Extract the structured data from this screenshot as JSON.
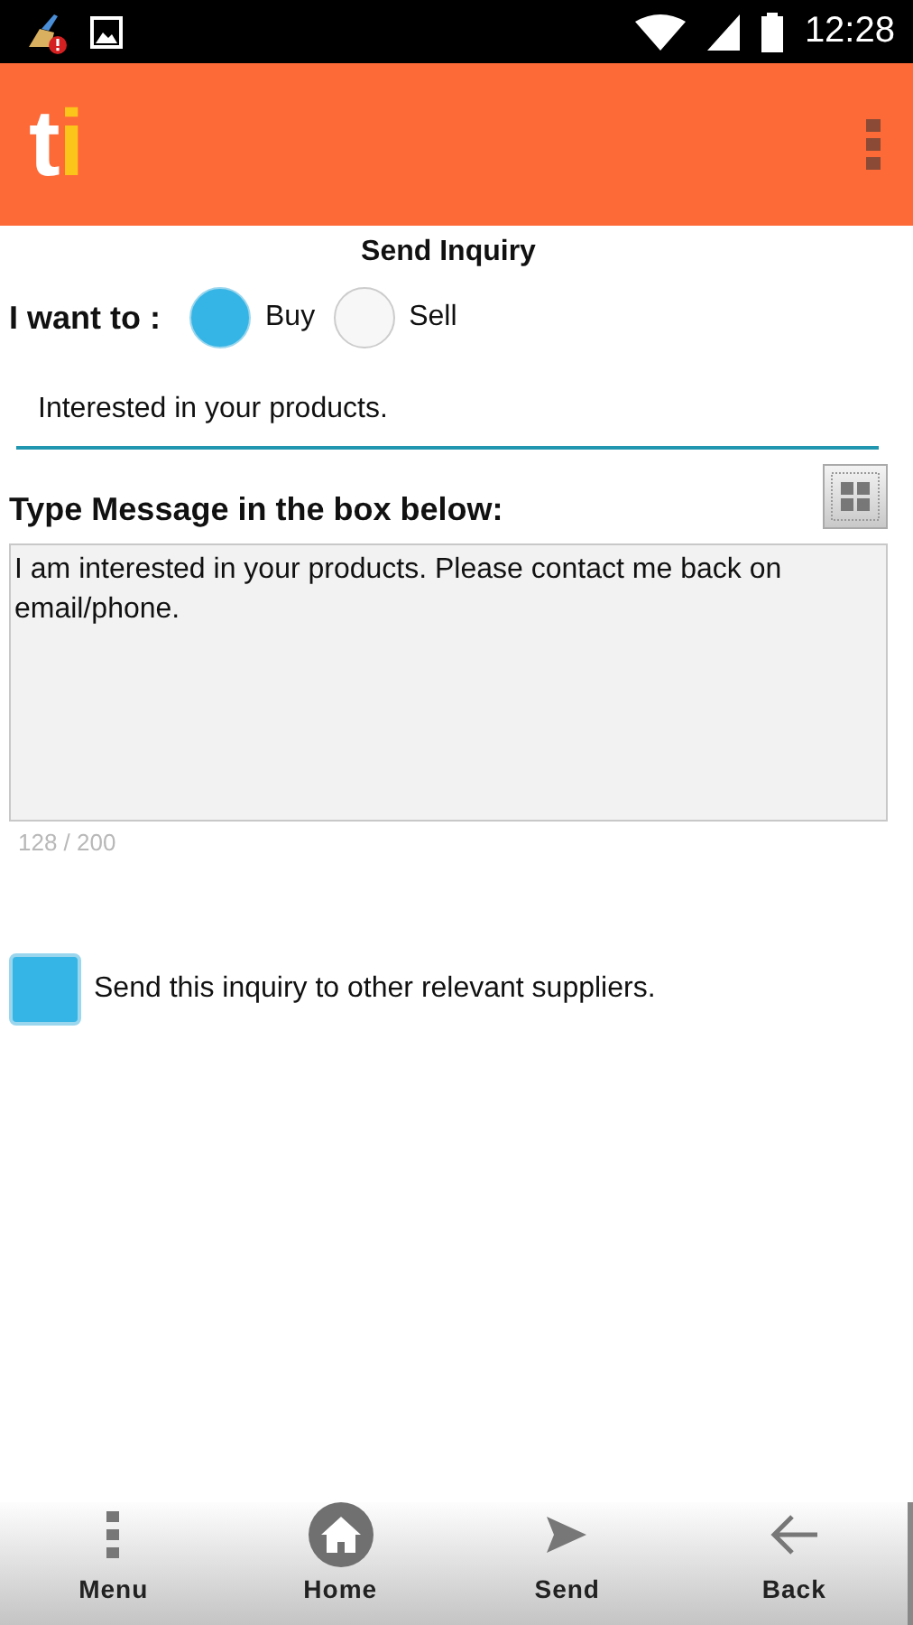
{
  "status_bar": {
    "time": "12:28"
  },
  "app_bar": {
    "logo_main": "t",
    "logo_accent": "i"
  },
  "form": {
    "title": "Send Inquiry",
    "intent_label": "I want to :",
    "options": [
      {
        "label": "Buy",
        "selected": true
      },
      {
        "label": "Sell",
        "selected": false
      }
    ],
    "subject": {
      "value": "Interested in your products."
    },
    "message_label": "Type Message in the box below:",
    "message": {
      "value": "I am interested in your products. Please contact me back on email/phone."
    },
    "counter": "128 / 200",
    "other_suppliers": {
      "label": "Send this inquiry to other relevant suppliers.",
      "checked": true
    }
  },
  "bottom_nav": [
    {
      "kind": "menu",
      "label": "Menu",
      "selected": false
    },
    {
      "kind": "home",
      "label": "Home",
      "selected": true
    },
    {
      "kind": "send",
      "label": "Send",
      "selected": false
    },
    {
      "kind": "back",
      "label": "Back",
      "selected": false
    }
  ]
}
